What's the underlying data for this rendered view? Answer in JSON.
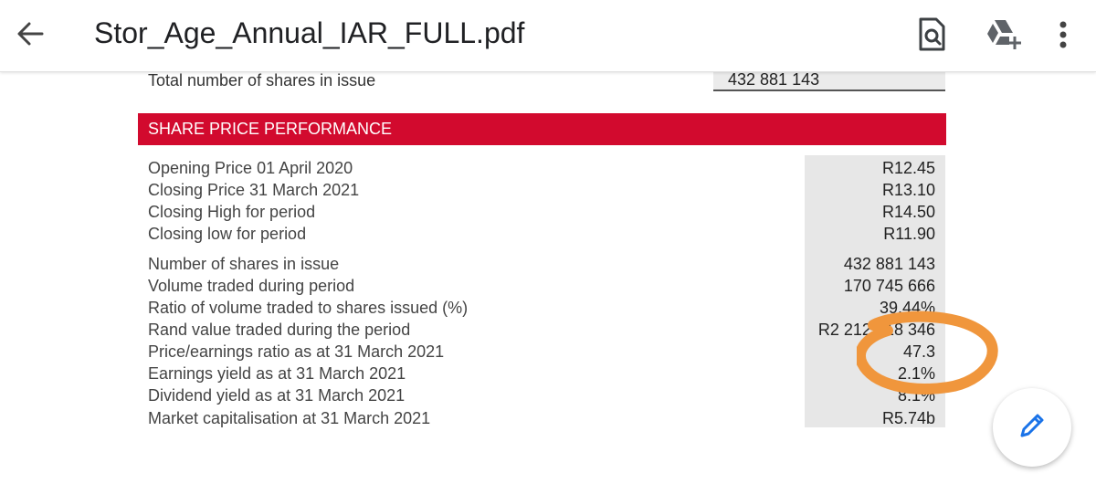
{
  "app": {
    "doc_title": "Stor_Age_Annual_IAR_FULL.pdf",
    "icons": [
      "back-arrow-icon",
      "find-in-page-icon",
      "add-to-drive-icon",
      "more-vert-icon",
      "edit-pencil-icon"
    ]
  },
  "document": {
    "shares_label": "Total number of shares in issue",
    "shares_value": "432 881 143",
    "section_title": "SHARE PRICE PERFORMANCE",
    "rows": [
      {
        "label": "Opening Price 01 April 2020",
        "value": "R12.45"
      },
      {
        "label": "Closing Price 31 March 2021",
        "value": "R13.10"
      },
      {
        "label": "Closing High for period",
        "value": "R14.50"
      },
      {
        "label": "Closing low for period",
        "value": "R11.90"
      },
      {
        "label": "Number of shares in issue",
        "value": "432 881 143"
      },
      {
        "label": "Volume traded during period",
        "value": "170 745 666"
      },
      {
        "label": "Ratio of volume traded to shares issued (%)",
        "value": "39.44%"
      },
      {
        "label": "Rand value traded during the period",
        "value": "R2 212 818 346"
      },
      {
        "label": "Price/earnings ratio as at 31 March 2021",
        "value": "47.3"
      },
      {
        "label": "Earnings yield as at 31 March 2021",
        "value": "2.1%"
      },
      {
        "label": "Dividend yield as at 31 March 2021",
        "value": "8.1%"
      },
      {
        "label": "Market capitalisation at 31 March 2021",
        "value": "R5.74b"
      }
    ]
  },
  "colors": {
    "section_bar": "#d20a2e",
    "value_column": "#e7e7e7",
    "annotation_stroke": "#f0963c",
    "fab_icon": "#1a73e8"
  }
}
